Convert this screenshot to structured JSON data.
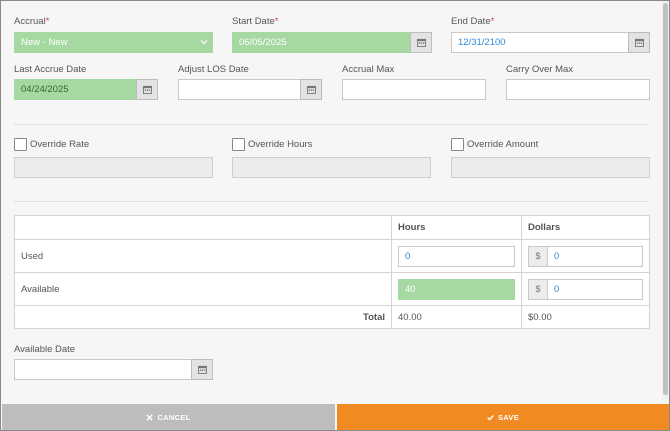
{
  "form": {
    "accrual": {
      "label": "Accrual",
      "required_mark": "*",
      "value": "New - New"
    },
    "start_date": {
      "label": "Start Date",
      "required_mark": "*",
      "value": "06/05/2025"
    },
    "end_date": {
      "label": "End Date",
      "required_mark": "*",
      "value": "12/31/2100"
    },
    "last_accrue_date": {
      "label": "Last Accrue Date",
      "value": "04/24/2025"
    },
    "adjust_los_date": {
      "label": "Adjust LOS Date",
      "value": ""
    },
    "accrual_max": {
      "label": "Accrual Max",
      "value": ""
    },
    "carry_over_max": {
      "label": "Carry Over Max",
      "value": ""
    },
    "override_rate": {
      "label": "Override Rate",
      "checked": false,
      "value": ""
    },
    "override_hours": {
      "label": "Override Hours",
      "checked": false,
      "value": ""
    },
    "override_amount": {
      "label": "Override Amount",
      "checked": false,
      "value": ""
    },
    "available_date": {
      "label": "Available Date",
      "value": ""
    }
  },
  "balance_table": {
    "headers": {
      "hours": "Hours",
      "dollars": "Dollars"
    },
    "currency_symbol": "$",
    "rows": [
      {
        "label": "Used",
        "hours": "0",
        "dollars": "0"
      },
      {
        "label": "Available",
        "hours": "40",
        "dollars": "0"
      }
    ],
    "total": {
      "label": "Total",
      "hours": "40.00",
      "dollars": "$0.00"
    }
  },
  "buttons": {
    "cancel": "CANCEL",
    "save": "SAVE"
  },
  "colors": {
    "highlight_green": "#a5d9a1",
    "required_red": "#e04040",
    "value_blue": "#2e8ad8",
    "cancel_gray": "#bdbdbd",
    "save_orange": "#f28a22"
  }
}
